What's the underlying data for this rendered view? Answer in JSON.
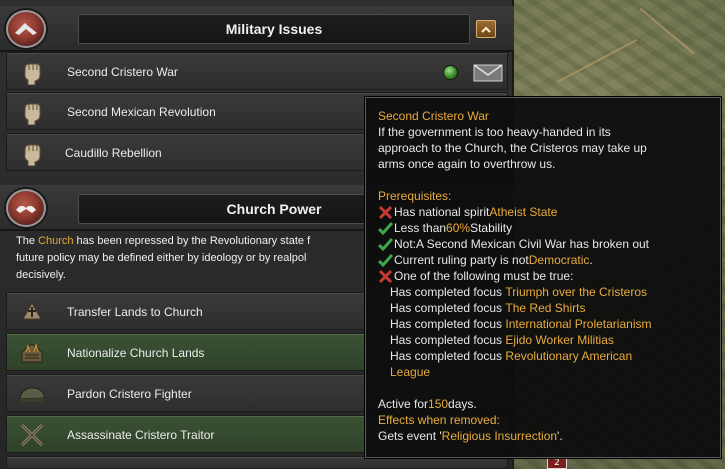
{
  "military_issues": {
    "title": "Military Issues",
    "items": [
      {
        "label": "Second Cristero War",
        "icon": "fist-icon"
      },
      {
        "label": "Second Mexican Revolution",
        "icon": "fist-icon"
      },
      {
        "label": "Caudillo Rebellion",
        "icon": "fist-icon"
      }
    ]
  },
  "church_power": {
    "title": "Church Power",
    "description": {
      "p1": "The ",
      "church": "Church",
      "p2": " has been repressed by the Revolutionary state f",
      "line2": "future policy may be defined either by ideology or by realpol",
      "line3": "decisively."
    },
    "items": [
      {
        "label": "Transfer Lands to Church",
        "icon": "church-deed-icon"
      },
      {
        "label": "Nationalize Church Lands",
        "icon": "burning-church-icon"
      },
      {
        "label": "Pardon Cristero Fighter",
        "icon": "soldier-cap-icon"
      },
      {
        "label": "Assassinate Cristero Traitor",
        "icon": "crossed-rifles-icon"
      }
    ]
  },
  "tooltip": {
    "title": "Second Cristero War",
    "desc1": "If the government is too heavy-handed in its",
    "desc2": "approach to the Church, the Cristeros may take up",
    "desc3": "arms once again to overthrow us.",
    "prereq_label": "Prerequisites:",
    "c1_text": "Has national spirit ",
    "c1_value": "Atheist State",
    "c2_text": "Less than ",
    "c2_value": "60%",
    "c2_suffix": " Stability",
    "c3_text": "Not:A Second Mexican Civil War has broken out",
    "c4_text": "Current ruling party is not ",
    "c4_value": "Democratic",
    "c4_suffix": ".",
    "c5_text": "One of the following must be true:",
    "focus_prefix": "Has completed focus ",
    "focuses": [
      "Triumph over the Cristeros",
      "The Red Shirts",
      "International Proletarianism",
      "Ejido Worker Militias",
      "Revolutionary American"
    ],
    "focus_wrap": "League",
    "active_text": "Active for ",
    "active_days": "150",
    "active_suffix": " days.",
    "effects_label": "Effects when removed:",
    "effect_text": "Gets event '",
    "effect_value": "Religious Insurrection",
    "effect_suffix": "'."
  },
  "map_badge": "2",
  "colors": {
    "gold": "#e9ac3d",
    "pass": "#3fa64a",
    "fail": "#c8382f",
    "active_row": "#3c5234"
  }
}
